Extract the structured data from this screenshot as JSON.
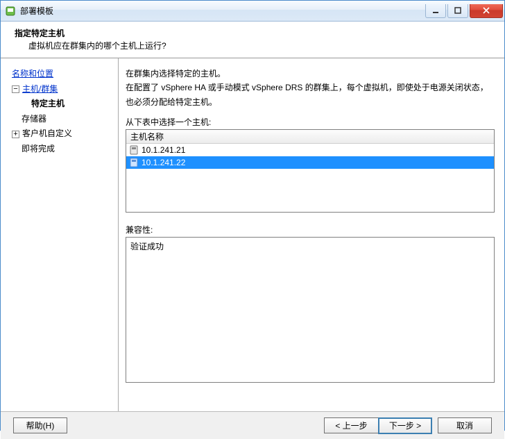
{
  "window": {
    "title": "部署模板",
    "controls": {
      "min": "–",
      "max": "▢",
      "close": "✕"
    }
  },
  "header": {
    "title": "指定特定主机",
    "subtitle": "虚拟机应在群集内的哪个主机上运行?"
  },
  "nav": {
    "step1": "名称和位置",
    "step2": "主机/群集",
    "step2a": "特定主机",
    "step3": "存储器",
    "step4": "客户机自定义",
    "step5": "即将完成"
  },
  "content": {
    "line1": "在群集内选择特定的主机。",
    "line2": "在配置了 vSphere HA 或手动模式 vSphere DRS 的群集上，每个虚拟机，即使处于电源关闭状态，也必须分配给特定主机。",
    "table_prompt": "从下表中选择一个主机:",
    "column_header": "主机名称",
    "hosts": [
      {
        "ip": "10.1.241.21",
        "selected": false
      },
      {
        "ip": "10.1.241.22",
        "selected": true
      }
    ],
    "compat_label": "兼容性:",
    "compat_result": "验证成功"
  },
  "footer": {
    "help": "帮助(H)",
    "back": "< 上一步",
    "next": "下一步 >",
    "cancel": "取消"
  }
}
